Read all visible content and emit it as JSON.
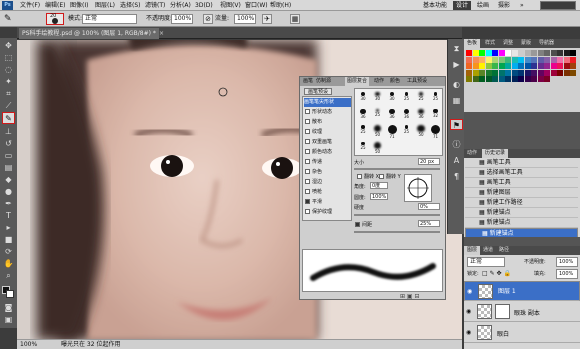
{
  "menubar": {
    "app_logo": "Ps",
    "items": [
      "文件(F)",
      "编辑(E)",
      "图像(I)",
      "图层(L)",
      "选择(S)",
      "滤镜(T)",
      "分析(A)",
      "3D(D)",
      "视图(V)",
      "窗口(W)",
      "帮助(H)"
    ],
    "workspaces": [
      "基本功能",
      "设计",
      "绘画",
      "摄影"
    ],
    "active_workspace": "设计",
    "more": "»"
  },
  "options": {
    "brush_size": "20",
    "mode_label": "模式:",
    "mode_value": "正常",
    "opacity_label": "不透明度:",
    "opacity_value": "100%",
    "flow_label": "流量:",
    "flow_value": "100%"
  },
  "document": {
    "tab_title": "PS科手绘教程.psd @ 100% (图层 1, RGB/8#) *",
    "zoom": "100%",
    "status": "曝光只在 32 位起作用"
  },
  "brush_panel": {
    "tabs": [
      "画笔",
      "仿制源",
      "图层复合",
      "动作",
      "颜色",
      "工具预设"
    ],
    "active_tab": "画笔",
    "preset_button": "画笔预设",
    "options": [
      {
        "label": "画笔笔尖形状",
        "checked": false,
        "highlight": true
      },
      {
        "label": "形状动态",
        "checked": false,
        "highlight": false
      },
      {
        "label": "散布",
        "checked": false,
        "highlight": false
      },
      {
        "label": "纹理",
        "checked": false,
        "highlight": false
      },
      {
        "label": "双重画笔",
        "checked": false,
        "highlight": false
      },
      {
        "label": "颜色动态",
        "checked": false,
        "highlight": false
      },
      {
        "label": "传递",
        "checked": false,
        "highlight": false
      },
      {
        "label": "杂色",
        "checked": false,
        "highlight": false
      },
      {
        "label": "湿边",
        "checked": false,
        "highlight": false
      },
      {
        "label": "喷枪",
        "checked": false,
        "highlight": false
      },
      {
        "label": "平滑",
        "checked": true,
        "highlight": false
      },
      {
        "label": "保护纹理",
        "checked": false,
        "highlight": false
      }
    ],
    "tip_sizes": [
      "30",
      "30",
      "30",
      "25",
      "25",
      "25",
      "36",
      "25",
      "36",
      "36",
      "36",
      "32",
      "25",
      "50",
      "71",
      "25",
      "50",
      "71",
      "25",
      "50"
    ],
    "size_label": "大小",
    "size_value": "20 px",
    "flipx_label": "翻转 X",
    "flipy_label": "翻转 Y",
    "angle_label": "角度:",
    "angle_value": "0度",
    "roundness_label": "圆度:",
    "roundness_value": "100%",
    "hardness_label": "硬度",
    "hardness_value": "0%",
    "spacing_label": "间距",
    "spacing_value": "25%"
  },
  "swatches_panel": {
    "tabs": [
      "色板",
      "样式",
      "调整",
      "蒙版",
      "导航器"
    ],
    "active_tab": "色板",
    "colors": [
      "#ff0000",
      "#ffff00",
      "#00ff00",
      "#00ffff",
      "#0000ff",
      "#ff00ff",
      "#ffffff",
      "#e6e6e6",
      "#cccccc",
      "#b3b3b3",
      "#999999",
      "#808080",
      "#666666",
      "#4d4d4d",
      "#333333",
      "#1a1a1a",
      "#000000",
      "#f26c4f",
      "#f68e55",
      "#fbaf5c",
      "#fff467",
      "#acd372",
      "#7cc576",
      "#3bb878",
      "#1abbb4",
      "#00bff3",
      "#438ccb",
      "#5574b9",
      "#605ca8",
      "#855fa8",
      "#a763a8",
      "#f06ea9",
      "#f26d7d",
      "#ed1c24",
      "#f26522",
      "#f7941d",
      "#fff200",
      "#8dc63f",
      "#39b54a",
      "#00a651",
      "#00a99d",
      "#00aeef",
      "#0072bc",
      "#0054a6",
      "#2e3192",
      "#662d91",
      "#92278f",
      "#ec008c",
      "#ed145b",
      "#9e0b0f",
      "#a0410d",
      "#a36209",
      "#aba000",
      "#598527",
      "#1a7b30",
      "#007236",
      "#00746b",
      "#0076a3",
      "#004b80",
      "#003471",
      "#1b1464",
      "#440e62",
      "#630460",
      "#9e005d",
      "#9e0039",
      "#790000",
      "#7b2e00",
      "#7d4900",
      "#827b00",
      "#406618",
      "#005e20",
      "#005826",
      "#005952",
      "#005b7f",
      "#003663",
      "#002157",
      "#0d004c",
      "#32004b",
      "#4b0049",
      "#7b0046",
      "#7a0026"
    ]
  },
  "history_panel": {
    "tabs": [
      "动作",
      "历史记录"
    ],
    "active_tab": "历史记录",
    "items": [
      "画笔工具",
      "选择画笔工具",
      "画笔工具",
      "新建图层",
      "新建工作路径",
      "新建锚点",
      "新建锚点",
      "新建锚点"
    ],
    "selected_index": 7
  },
  "layers_panel": {
    "tabs": [
      "图层",
      "通道",
      "路径"
    ],
    "active_tab": "图层",
    "blend_mode": "正常",
    "opacity_label": "不透明度:",
    "opacity_value": "100%",
    "lock_label": "锁定:",
    "fill_label": "填充:",
    "fill_value": "100%",
    "layers": [
      {
        "name": "图层 1",
        "selected": true
      },
      {
        "name": "眼珠 副本",
        "selected": false
      },
      {
        "name": "眼白",
        "selected": false
      }
    ]
  }
}
